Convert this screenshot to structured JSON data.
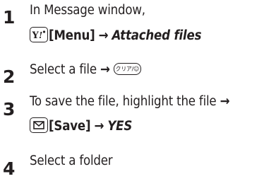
{
  "steps": [
    {
      "number": "1",
      "line1": "In Message window,",
      "key_icon": "y-key-icon",
      "menu_label": "[Menu]",
      "arrow": "→",
      "target": "Attached files"
    },
    {
      "number": "2",
      "text": "Select a file",
      "arrow": "→",
      "key_icon": "clear-key-icon",
      "key_text": "クリア/☺"
    },
    {
      "number": "3",
      "line1": "To save the file, highlight the file",
      "arrow1": "→",
      "key_icon": "mail-key-icon",
      "action_label": "[Save]",
      "arrow2": "→",
      "confirm": "YES"
    },
    {
      "number": "4",
      "text": "Select a folder"
    }
  ]
}
